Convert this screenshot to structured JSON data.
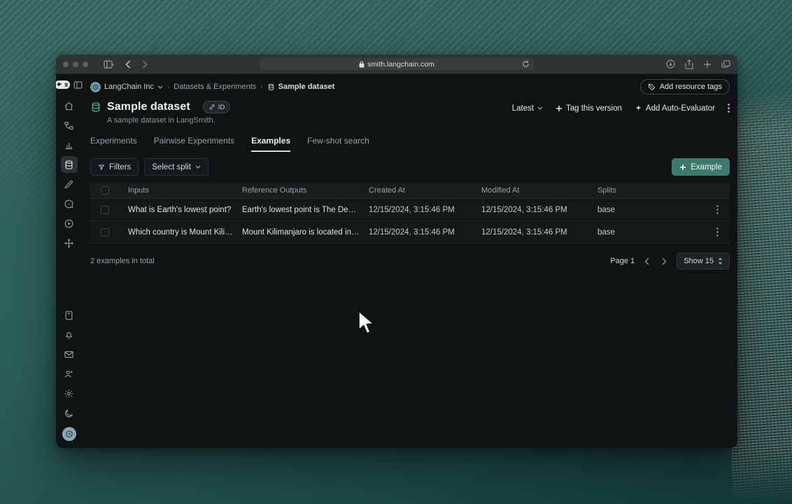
{
  "browser": {
    "url": "smith.langchain.com"
  },
  "breadcrumb": {
    "org": "LangChain Inc",
    "section": "Datasets & Experiments",
    "page": "Sample dataset"
  },
  "topbar": {
    "add_resource_tags": "Add resource tags"
  },
  "dataset": {
    "title": "Sample dataset",
    "description": "A sample dataset in LangSmith.",
    "id_badge": "ID"
  },
  "actions": {
    "version": "Latest",
    "tag_version": "Tag this version",
    "add_auto_evaluator": "Add Auto-Evaluator"
  },
  "tabs": [
    {
      "label": "Experiments",
      "active": false
    },
    {
      "label": "Pairwise Experiments",
      "active": false
    },
    {
      "label": "Examples",
      "active": true
    },
    {
      "label": "Few-shot search",
      "active": false
    }
  ],
  "toolbar": {
    "filters": "Filters",
    "select_split": "Select split",
    "add_example": "Example"
  },
  "table": {
    "columns": [
      "Inputs",
      "Reference Outputs",
      "Created At",
      "Modified At",
      "Splits"
    ],
    "rows": [
      {
        "inputs": "What is Earth's lowest point?",
        "reference_outputs": "Earth's lowest point is The Dead Sea.",
        "created_at": "12/15/2024, 3:15:46 PM",
        "modified_at": "12/15/2024, 3:15:46 PM",
        "splits": "base"
      },
      {
        "inputs": "Which country is Mount Kilimanjaro...",
        "reference_outputs": "Mount Kilimanjaro is located in Tanzania.",
        "created_at": "12/15/2024, 3:15:46 PM",
        "modified_at": "12/15/2024, 3:15:46 PM",
        "splits": "base"
      }
    ]
  },
  "pagination": {
    "total": "2 examples in total",
    "page": "Page 1",
    "show": "Show 15"
  },
  "sidebar": {
    "selected": "datasets",
    "top": [
      "home",
      "tracing-projects",
      "monitoring",
      "datasets",
      "annotation-queues",
      "prompts",
      "playground",
      "deployments"
    ],
    "bottom": [
      "docs",
      "notifications",
      "mail",
      "invite-members",
      "settings",
      "dark-mode"
    ]
  },
  "colors": {
    "accent_button": "#3c7a6e",
    "dataset_icon": "#36b09c",
    "page_background": "#2d5e58",
    "window_background": "#0f1314"
  }
}
